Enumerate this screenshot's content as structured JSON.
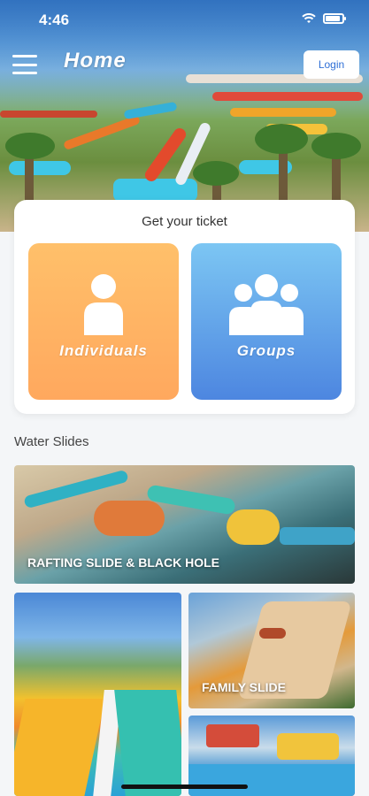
{
  "status_bar": {
    "time": "4:46",
    "wifi_icon": "wifi-icon",
    "battery_icon": "battery-icon"
  },
  "header": {
    "title": "Home",
    "menu_icon": "hamburger-menu-icon",
    "login_label": "Login"
  },
  "ticket": {
    "heading": "Get your ticket",
    "options": [
      {
        "label": "Individuals",
        "icon": "person-icon",
        "color": "#ffb062"
      },
      {
        "label": "Groups",
        "icon": "group-icon",
        "color": "#5a97e6"
      }
    ]
  },
  "water_slides": {
    "heading": "Water Slides",
    "cards": [
      {
        "label": "RAFTING SLIDE & BLACK HOLE"
      },
      {
        "label": ""
      },
      {
        "label": "FAMILY SLIDE"
      },
      {
        "label": ""
      }
    ]
  },
  "colors": {
    "brand_blue": "#2f6fd6",
    "background": "#f4f6f8"
  }
}
